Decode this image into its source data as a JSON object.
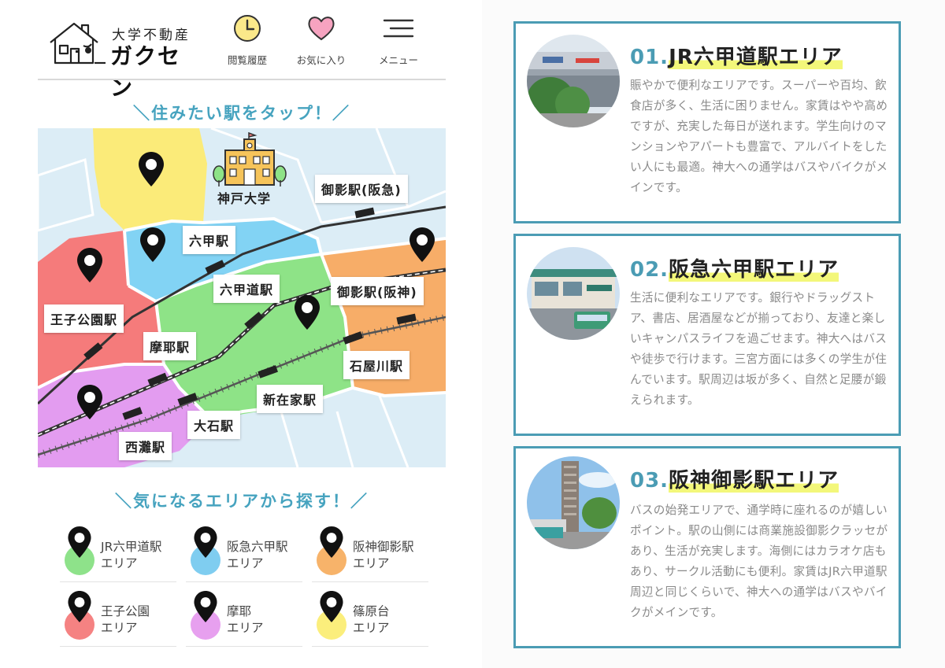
{
  "header": {
    "logo_sub": "大学不動産",
    "logo_main": "ガクセン",
    "buttons": [
      {
        "label": "閲覧履歴",
        "icon": "clock-icon"
      },
      {
        "label": "お気に入り",
        "icon": "heart-icon"
      },
      {
        "label": "メニュー",
        "icon": "menu-icon"
      }
    ]
  },
  "map_section": {
    "title": "＼住みたい駅をタップ！／",
    "campus_label": "神戸大学",
    "stations": [
      "御影駅(阪急)",
      "六甲駅",
      "六甲道駅",
      "御影駅(阪神)",
      "王子公園駅",
      "摩耶駅",
      "石屋川駅",
      "新在家駅",
      "大石駅",
      "西灘駅"
    ]
  },
  "area_section": {
    "title": "＼気になるエリアから探す！／",
    "areas": [
      {
        "line1": "JR六甲道駅",
        "line2": "エリア",
        "color": "#8ee28a"
      },
      {
        "line1": "阪急六甲駅",
        "line2": "エリア",
        "color": "#7fcdf0"
      },
      {
        "line1": "阪神御影駅",
        "line2": "エリア",
        "color": "#f7b36a"
      },
      {
        "line1": "王子公園",
        "line2": "エリア",
        "color": "#f58282"
      },
      {
        "line1": "摩耶",
        "line2": "エリア",
        "color": "#e7a0ef"
      },
      {
        "line1": "篠原台",
        "line2": "エリア",
        "color": "#fbee7c"
      }
    ]
  },
  "cards": [
    {
      "num": "01.",
      "title": "JR六甲道駅エリア",
      "desc": "賑やかで便利なエリアです。スーパーや百均、飲食店が多く、生活に困りません。家賃はやや高めですが、充実した毎日が送れます。学生向けのマンションやアパートも豊富で、アルバイトをしたい人にも最適。神大への通学はバスやバイクがメインです。"
    },
    {
      "num": "02.",
      "title": "阪急六甲駅エリア",
      "desc": "生活に便利なエリアです。銀行やドラッグストア、書店、居酒屋などが揃っており、友達と楽しいキャンパスライフを過ごせます。神大へはバスや徒歩で行けます。三宮方面には多くの学生が住んでいます。駅周辺は坂が多く、自然と足腰が鍛えられます。"
    },
    {
      "num": "03.",
      "title": "阪神御影駅エリア",
      "desc": "バスの始発エリアで、通学時に座れるのが嬉しいポイント。駅の山側には商業施設御影クラッセがあり、生活が充実します。海側にはカラオケ店もあり、サークル活動にも便利。家賃はJR六甲道駅周辺と同じくらいで、神大への通学はバスやバイクがメインです。"
    }
  ],
  "colors": {
    "accent": "#46a3bf",
    "card_border": "#4b9cb4",
    "highlight": "#f3f77a"
  }
}
